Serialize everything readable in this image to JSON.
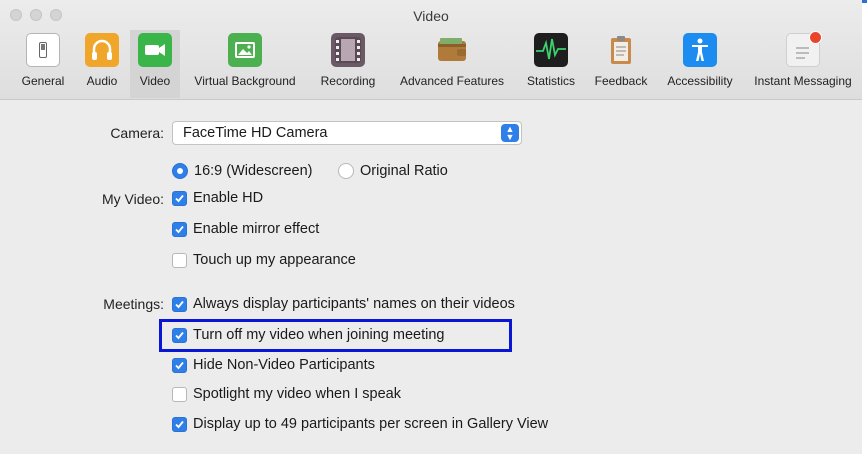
{
  "window": {
    "title": "Video"
  },
  "toolbar": {
    "items": [
      {
        "label": "General",
        "icon": "general-switch-icon"
      },
      {
        "label": "Audio",
        "icon": "headphones-icon"
      },
      {
        "label": "Video",
        "icon": "video-camera-icon",
        "selected": true
      },
      {
        "label": "Virtual Background",
        "icon": "picture-icon"
      },
      {
        "label": "Recording",
        "icon": "film-strip-icon"
      },
      {
        "label": "Advanced Features",
        "icon": "wallet-icon"
      },
      {
        "label": "Statistics",
        "icon": "activity-monitor-icon"
      },
      {
        "label": "Feedback",
        "icon": "clipboard-icon"
      },
      {
        "label": "Accessibility",
        "icon": "accessibility-icon"
      },
      {
        "label": "Instant Messaging",
        "icon": "chat-notification-icon"
      }
    ]
  },
  "camera": {
    "label": "Camera:",
    "selected": "FaceTime HD Camera"
  },
  "my_video": {
    "label": "My Video:",
    "ratio_widescreen": "16:9 (Widescreen)",
    "ratio_original": "Original Ratio",
    "enable_hd": "Enable HD",
    "mirror": "Enable mirror effect",
    "touch_up": "Touch up my appearance"
  },
  "meetings": {
    "label": "Meetings:",
    "display_names": "Always display participants' names on their videos",
    "turn_off_video": "Turn off my video when joining meeting",
    "hide_non_video": "Hide Non-Video Participants",
    "spotlight": "Spotlight my video when I speak",
    "gallery_49": "Display up to 49 participants per screen in Gallery View"
  },
  "colors": {
    "accent": "#2f7fe8",
    "highlight": "#0a16d6"
  }
}
